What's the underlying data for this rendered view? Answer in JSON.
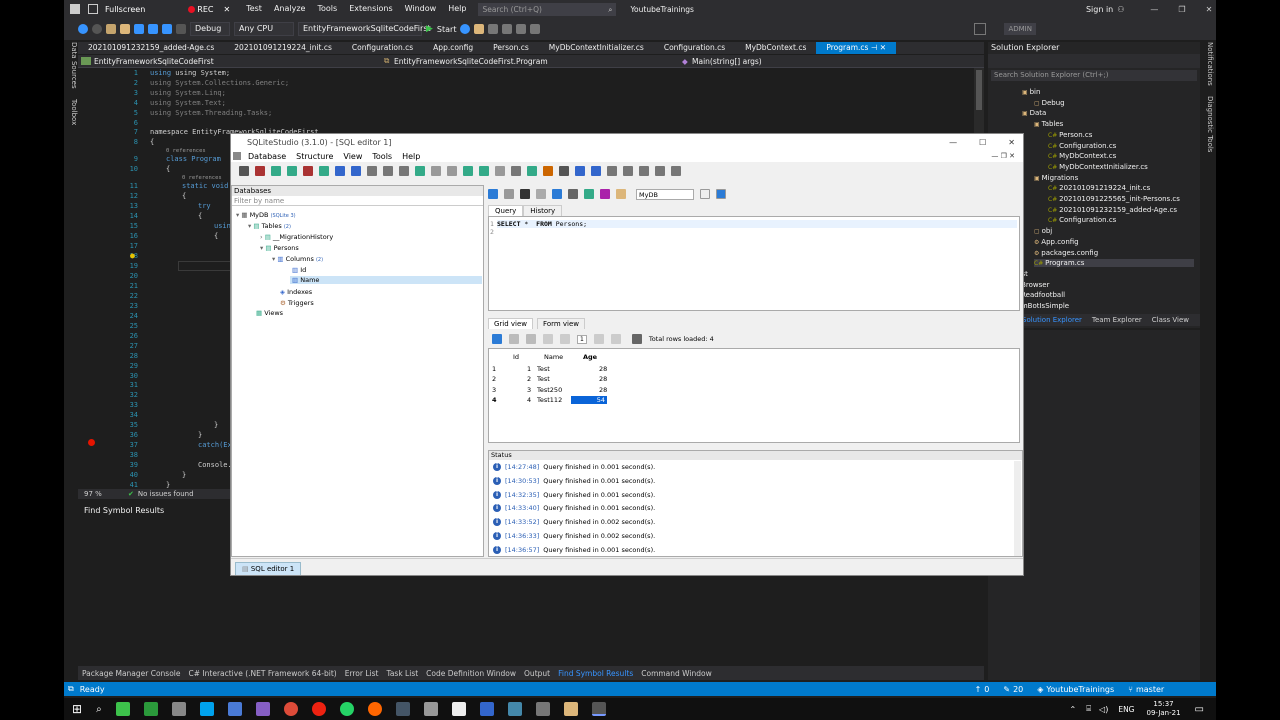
{
  "vs": {
    "menu": [
      "Test",
      "Analyze",
      "Tools",
      "Extensions",
      "Window",
      "Help"
    ],
    "search_placeholder": "Search (Ctrl+Q)",
    "solution_title": "YoutubeTrainings",
    "sign_in": "Sign in",
    "admin": "ADMIN",
    "recorder": {
      "fullscreen": "Fullscreen",
      "rec": "REC"
    },
    "toolbar": {
      "config": "Debug",
      "platform": "Any CPU",
      "project": "EntityFrameworkSqliteCodeFirst",
      "start": "Start"
    },
    "tabs": [
      "202101091232159_added-Age.cs",
      "202101091219224_init.cs",
      "Configuration.cs",
      "App.config",
      "Person.cs",
      "MyDbContextInitializer.cs",
      "Configuration.cs",
      "MyDbContext.cs",
      "Program.cs"
    ],
    "navbar": {
      "project": "EntityFrameworkSqliteCodeFirst",
      "class": "EntityFrameworkSqliteCodeFirst.Program",
      "method": "Main(string[] args)"
    },
    "left_rail": [
      "Data Sources",
      "Toolbox"
    ],
    "right_rail": [
      "Notifications",
      "Diagnostic Tools"
    ],
    "code": {
      "lines": [
        "1",
        "2",
        "3",
        "4",
        "5",
        "6",
        "7",
        "8",
        "9",
        "10",
        "11",
        "12",
        "13",
        "14",
        "15",
        "16",
        "17",
        "18",
        "19",
        "20",
        "21",
        "22",
        "23",
        "24",
        "25",
        "26",
        "27",
        "28",
        "29",
        "30",
        "31",
        "32",
        "33",
        "34",
        "35",
        "36",
        "37",
        "38",
        "39",
        "40",
        "41"
      ],
      "l1": "using System;",
      "l2": "using System.Collections.Generic;",
      "l3": "using System.Linq;",
      "l4": "using System.Text;",
      "l5": "using System.Threading.Tasks;",
      "l7": "namespace EntityFrameworkSqliteCodeFirst",
      "l8": "{",
      "l9ref": "0 references",
      "l9": "class Program",
      "l10": "{",
      "l11ref": "0 references",
      "l11": "static void Ma",
      "l12": "{",
      "l13": "try",
      "l14": "{",
      "l15": "using(",
      "l16": "{",
      "l17": "va",
      "l18": "co",
      "l19": "co",
      "l21": "bo",
      "l22": "fo",
      "l23": "{",
      "l29": "}",
      "l31": "if",
      "l32": "{",
      "l34": "}",
      "l35": "}",
      "l36": "}",
      "l37": "catch(Excep",
      "l39": "Console.Rea",
      "l40": "}",
      "l41": "}"
    },
    "zoom": "97 %",
    "issues": "No issues found",
    "find_symbol": "Find Symbol Results",
    "bottom_tabs": [
      "Package Manager Console",
      "C# Interactive (.NET Framework 64-bit)",
      "Error List",
      "Task List",
      "Code Definition Window",
      "Output",
      "Find Symbol Results",
      "Command Window"
    ],
    "status": {
      "ready": "Ready",
      "up": "0",
      "pencil": "20",
      "repo": "YoutubeTrainings",
      "branch": "master"
    },
    "solution_explorer": {
      "title": "Solution Explorer",
      "search": "Search Solution Explorer (Ctrl+;)",
      "items": [
        "bin",
        "Debug",
        "Data",
        "Tables",
        "Person.cs",
        "Configuration.cs",
        "MyDbContext.cs",
        "MyDbContextInitializer.cs",
        "Migrations",
        "202101091219224_init.cs",
        "202101091225565_init-Persons.cs",
        "202101091232159_added-Age.cs",
        "Configuration.cs",
        "obj",
        "App.config",
        "packages.config",
        "Program.cs",
        "ExcelTest",
        "ParsingBrowser",
        "ParsingReadfootball",
        "TelegramBotIsSimple"
      ],
      "bottom_tabs": [
        "Solution Explorer",
        "Team Explorer",
        "Class View"
      ]
    }
  },
  "sqlite": {
    "title": "SQLiteStudio (3.1.0) - [SQL editor 1]",
    "menu": [
      "Database",
      "Structure",
      "View",
      "Tools",
      "Help"
    ],
    "db_panel_title": "Databases",
    "filter_placeholder": "Filter by name",
    "tree": {
      "db": "MyDB",
      "db_ver": "(SQLite 3)",
      "tables": "Tables",
      "tables_count": "(2)",
      "t1": "__MigrationHistory",
      "t2": "Persons",
      "cols": "Columns",
      "cols_count": "(2)",
      "c1": "Id",
      "c2": "Name",
      "idx": "Indexes",
      "trg": "Triggers",
      "views": "Views"
    },
    "db_combo": "MyDB",
    "query_tabs": [
      "Query",
      "History"
    ],
    "query_lines": [
      "1",
      "2"
    ],
    "query_kw1": "SELECT",
    "query_star": "*",
    "query_kw2": "FROM",
    "query_tbl": "Persons;",
    "result_tabs": [
      "Grid view",
      "Form view"
    ],
    "page": "1",
    "rows_loaded": "Total rows loaded: 4",
    "grid": {
      "headers": [
        "Id",
        "Name",
        "Age"
      ],
      "rows": [
        {
          "n": "1",
          "id": "1",
          "name": "Test",
          "age": "28"
        },
        {
          "n": "2",
          "id": "2",
          "name": "Test",
          "age": "28"
        },
        {
          "n": "3",
          "id": "3",
          "name": "Test250",
          "age": "28"
        },
        {
          "n": "4",
          "id": "4",
          "name": "Test112",
          "age": "54"
        }
      ]
    },
    "status_title": "Status",
    "status_lines": [
      {
        "t": "[14:27:48]",
        "m": "Query finished in 0.001 second(s)."
      },
      {
        "t": "[14:30:53]",
        "m": "Query finished in 0.001 second(s)."
      },
      {
        "t": "[14:32:35]",
        "m": "Query finished in 0.001 second(s)."
      },
      {
        "t": "[14:33:40]",
        "m": "Query finished in 0.001 second(s)."
      },
      {
        "t": "[14:33:52]",
        "m": "Query finished in 0.002 second(s)."
      },
      {
        "t": "[14:36:33]",
        "m": "Query finished in 0.002 second(s)."
      },
      {
        "t": "[14:36:57]",
        "m": "Query finished in 0.001 second(s)."
      }
    ],
    "bottom_tab": "SQL editor 1"
  },
  "taskbar": {
    "lang": "ENG",
    "time": "15:37",
    "date": "09-Jan-21"
  }
}
